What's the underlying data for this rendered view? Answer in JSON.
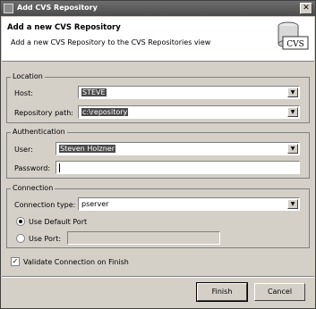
{
  "window": {
    "title": "Add CVS Repository",
    "close_glyph": "✕",
    "icon": "app-icon"
  },
  "header": {
    "title": "Add a new CVS Repository",
    "description": "Add a new CVS Repository to the CVS Repositories view",
    "banner_label": "CVS",
    "banner_icon": "cvs-repository-icon"
  },
  "location": {
    "group_label": "Location",
    "host_label": "Host:",
    "host_value": "STEVE",
    "path_label": "Repository path:",
    "path_value": "c:\\repository"
  },
  "authentication": {
    "group_label": "Authentication",
    "user_label": "User:",
    "user_value": "Steven Holzner",
    "password_label": "Password:",
    "password_value": ""
  },
  "connection": {
    "group_label": "Connection",
    "type_label": "Connection type:",
    "type_value": "pserver",
    "default_port_label": "Use Default Port",
    "default_port_selected": true,
    "use_port_label": "Use Port:",
    "use_port_selected": false,
    "port_value": ""
  },
  "validate": {
    "label": "Validate Connection on Finish",
    "checked": true,
    "check_glyph": "✓"
  },
  "buttons": {
    "finish": "Finish",
    "cancel": "Cancel"
  },
  "dropdown_arrow": "▼"
}
